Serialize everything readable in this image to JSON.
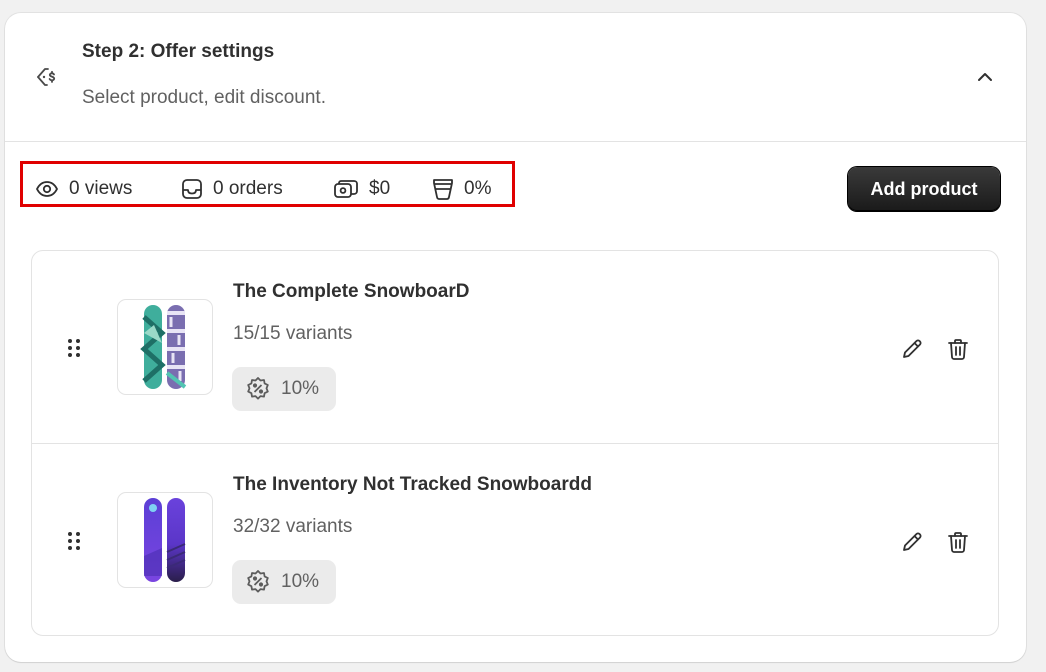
{
  "header": {
    "title": "Step 2: Offer settings",
    "subtitle": "Select product, edit discount.",
    "icon": "discount-tag-icon",
    "collapse_icon": "chevron-up-icon"
  },
  "stats": {
    "views": "0 views",
    "orders": "0 orders",
    "revenue": "$0",
    "conversion": "0%",
    "highlight_color": "#e00000"
  },
  "toolbar": {
    "add_product_label": "Add product"
  },
  "products": [
    {
      "name": "The Complete SnowboarD",
      "variants": "15/15 variants",
      "discount": "10%",
      "thumbnail": "snowboard-teal-image"
    },
    {
      "name": "The Inventory Not Tracked Snowboardd",
      "variants": "32/32 variants",
      "discount": "10%",
      "thumbnail": "snowboard-purple-image"
    }
  ],
  "colors": {
    "primary_button": "#303030",
    "badge_bg": "#ebebeb",
    "border": "#e3e3e3"
  }
}
